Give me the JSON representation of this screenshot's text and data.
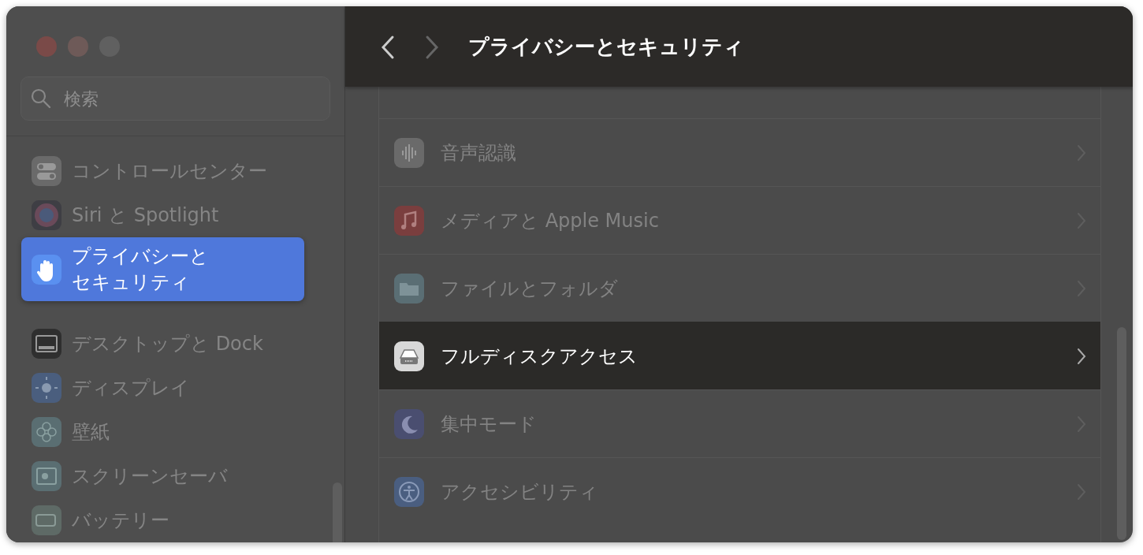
{
  "window": {
    "title": "プライバシーとセキュリティ"
  },
  "search": {
    "placeholder": "検索"
  },
  "sidebar": {
    "items": [
      {
        "label": "コントロールセンター",
        "selected": false
      },
      {
        "label": "Siri と Spotlight",
        "selected": false
      },
      {
        "label": "プライバシーとセキュリティ",
        "selected": true
      },
      {
        "label": "デスクトップと Dock",
        "selected": false
      },
      {
        "label": "ディスプレイ",
        "selected": false
      },
      {
        "label": "壁紙",
        "selected": false
      },
      {
        "label": "スクリーンセーバ",
        "selected": false
      },
      {
        "label": "バッテリー",
        "selected": false
      }
    ]
  },
  "settings": {
    "rows": [
      {
        "label": "音声認識",
        "selected": false
      },
      {
        "label": "メディアと Apple Music",
        "selected": false
      },
      {
        "label": "ファイルとフォルダ",
        "selected": false
      },
      {
        "label": "フルディスクアクセス",
        "selected": true
      },
      {
        "label": "集中モード",
        "selected": false
      },
      {
        "label": "アクセシビリティ",
        "selected": false
      }
    ]
  }
}
